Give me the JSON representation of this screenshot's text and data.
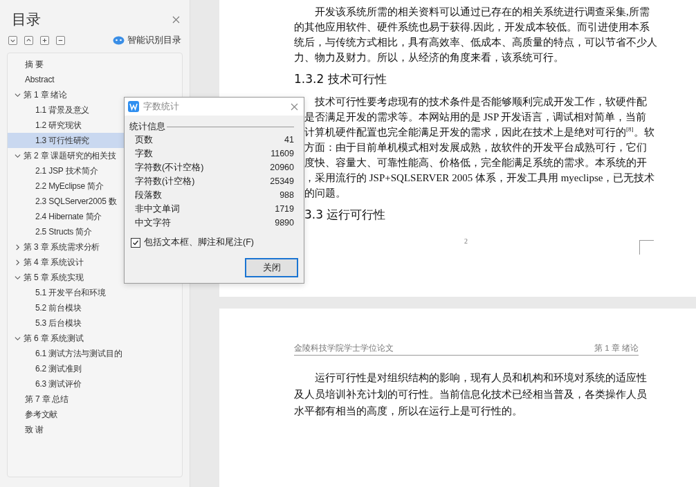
{
  "sidebar": {
    "title": "目录",
    "smart_toc": "智能识别目录",
    "items": [
      {
        "kind": "entry",
        "label": "摘 要",
        "selected": false
      },
      {
        "kind": "entry",
        "label": "Abstract",
        "selected": false
      },
      {
        "kind": "group",
        "label": "第 1 章  绪论",
        "expanded": true,
        "selected": false,
        "children": [
          {
            "label": "1.1 背景及意义",
            "selected": false
          },
          {
            "label": "1.2  研究现状",
            "selected": false
          },
          {
            "label": "1.3  可行性研究",
            "selected": true
          }
        ]
      },
      {
        "kind": "group",
        "label": "第 2 章  课题研究的相关技",
        "expanded": true,
        "selected": false,
        "children": [
          {
            "label": "2.1 JSP 技术简介",
            "selected": false
          },
          {
            "label": "2.2 MyEclipse 简介",
            "selected": false
          },
          {
            "label": "2.3 SQLServer2005 数",
            "selected": false
          },
          {
            "label": "2.4 Hibernate 简介",
            "selected": false
          },
          {
            "label": "2.5 Structs 简介",
            "selected": false
          }
        ]
      },
      {
        "kind": "group",
        "label": "第 3 章  系统需求分析",
        "expanded": false,
        "selected": false
      },
      {
        "kind": "group",
        "label": "第 4 章  系统设计",
        "expanded": false,
        "selected": false
      },
      {
        "kind": "group",
        "label": "第 5 章  系统实现",
        "expanded": true,
        "selected": false,
        "children": [
          {
            "label": "5.1  开发平台和环境",
            "selected": false
          },
          {
            "label": "5.2  前台模块",
            "selected": false
          },
          {
            "label": "5.3  后台模块",
            "selected": false
          }
        ]
      },
      {
        "kind": "group",
        "label": "第 6 章  系统测试",
        "expanded": true,
        "selected": false,
        "children": [
          {
            "label": "6.1  测试方法与测试目的",
            "selected": false
          },
          {
            "label": "6.2  测试准则",
            "selected": false
          },
          {
            "label": "6.3  测试评价",
            "selected": false
          }
        ]
      },
      {
        "kind": "entry",
        "label": "第 7 章  总结",
        "selected": false
      },
      {
        "kind": "entry",
        "label": "参考文献",
        "selected": false
      },
      {
        "kind": "entry",
        "label": "致 谢",
        "selected": false
      }
    ]
  },
  "page_1": {
    "lines": [
      {
        "kind": "indent",
        "text": "开发该系统所需的相关资料可以通过已存在的相关系统进行调查采集,所需"
      },
      {
        "kind": "plain",
        "text": "的其他应用软件、硬件系统也易于获得.因此，开发成本较低。而引进使用本系"
      },
      {
        "kind": "plain",
        "text": "统后，与传统方式相比，具有高效率、低成本、高质量的特点，可以节省不少人"
      },
      {
        "kind": "plain",
        "text": "力、物力及财力。所以，从经济的角度来看，该系统可行。"
      },
      {
        "kind": "heading",
        "text": "1.3.2 技术可行性"
      },
      {
        "kind": "indent",
        "text": "技术可行性要考虑现有的技术条件是否能够顺利完成开发工作，软硬件配"
      },
      {
        "kind": "covered",
        "text": "是否满足开发的需求等。本网站用的是 JSP 开发语言，调试相对简单，当前"
      },
      {
        "kind": "covered",
        "text": "计算机硬件配置也完全能满足开发的需求，因此在技术上是绝对可行的$^{[8]}$。软"
      },
      {
        "kind": "covered",
        "text": "方面：由于目前单机模式相对发展成熟，故软件的开发平台成熟可行，它们"
      },
      {
        "kind": "covered",
        "text": "度快、容量大、可靠性能高、价格低，完全能满足系统的需求。本系统的开"
      },
      {
        "kind": "covered",
        "text": "，采用流行的 JSP+SQLSERVER 2005 体系，开发工具用 myeclipse，已无技术"
      },
      {
        "kind": "covered",
        "text": "的问题。"
      },
      {
        "kind": "heading_covered",
        "text": "3.3 运行可行性"
      }
    ],
    "page_number": "2"
  },
  "page_2": {
    "header_left": "金陵科技学院学士学位论文",
    "header_right": "第 1 章  绪论",
    "lines": [
      {
        "kind": "indent",
        "text": "运行可行性是对组织结构的影响，现有人员和机构和环境对系统的适应性"
      },
      {
        "kind": "plain",
        "text": "及人员培训补充计划的可行性。当前信息化技术已经相当普及，各类操作人员"
      },
      {
        "kind": "plain",
        "text": "水平都有相当的高度，所以在运行上是可行性的。"
      }
    ]
  },
  "dialog": {
    "title": "字数统计",
    "group": "统计信息",
    "stats": [
      {
        "label": "页数",
        "value": "41"
      },
      {
        "label": "字数",
        "value": "11609"
      },
      {
        "label": "字符数(不计空格)",
        "value": "20960"
      },
      {
        "label": "字符数(计空格)",
        "value": "25349"
      },
      {
        "label": "段落数",
        "value": "988"
      },
      {
        "label": "非中文单词",
        "value": "1719"
      },
      {
        "label": "中文字符",
        "value": "9890"
      }
    ],
    "option": {
      "label": "包括文本框、脚注和尾注(F)",
      "checked": true
    },
    "button": "关闭"
  }
}
